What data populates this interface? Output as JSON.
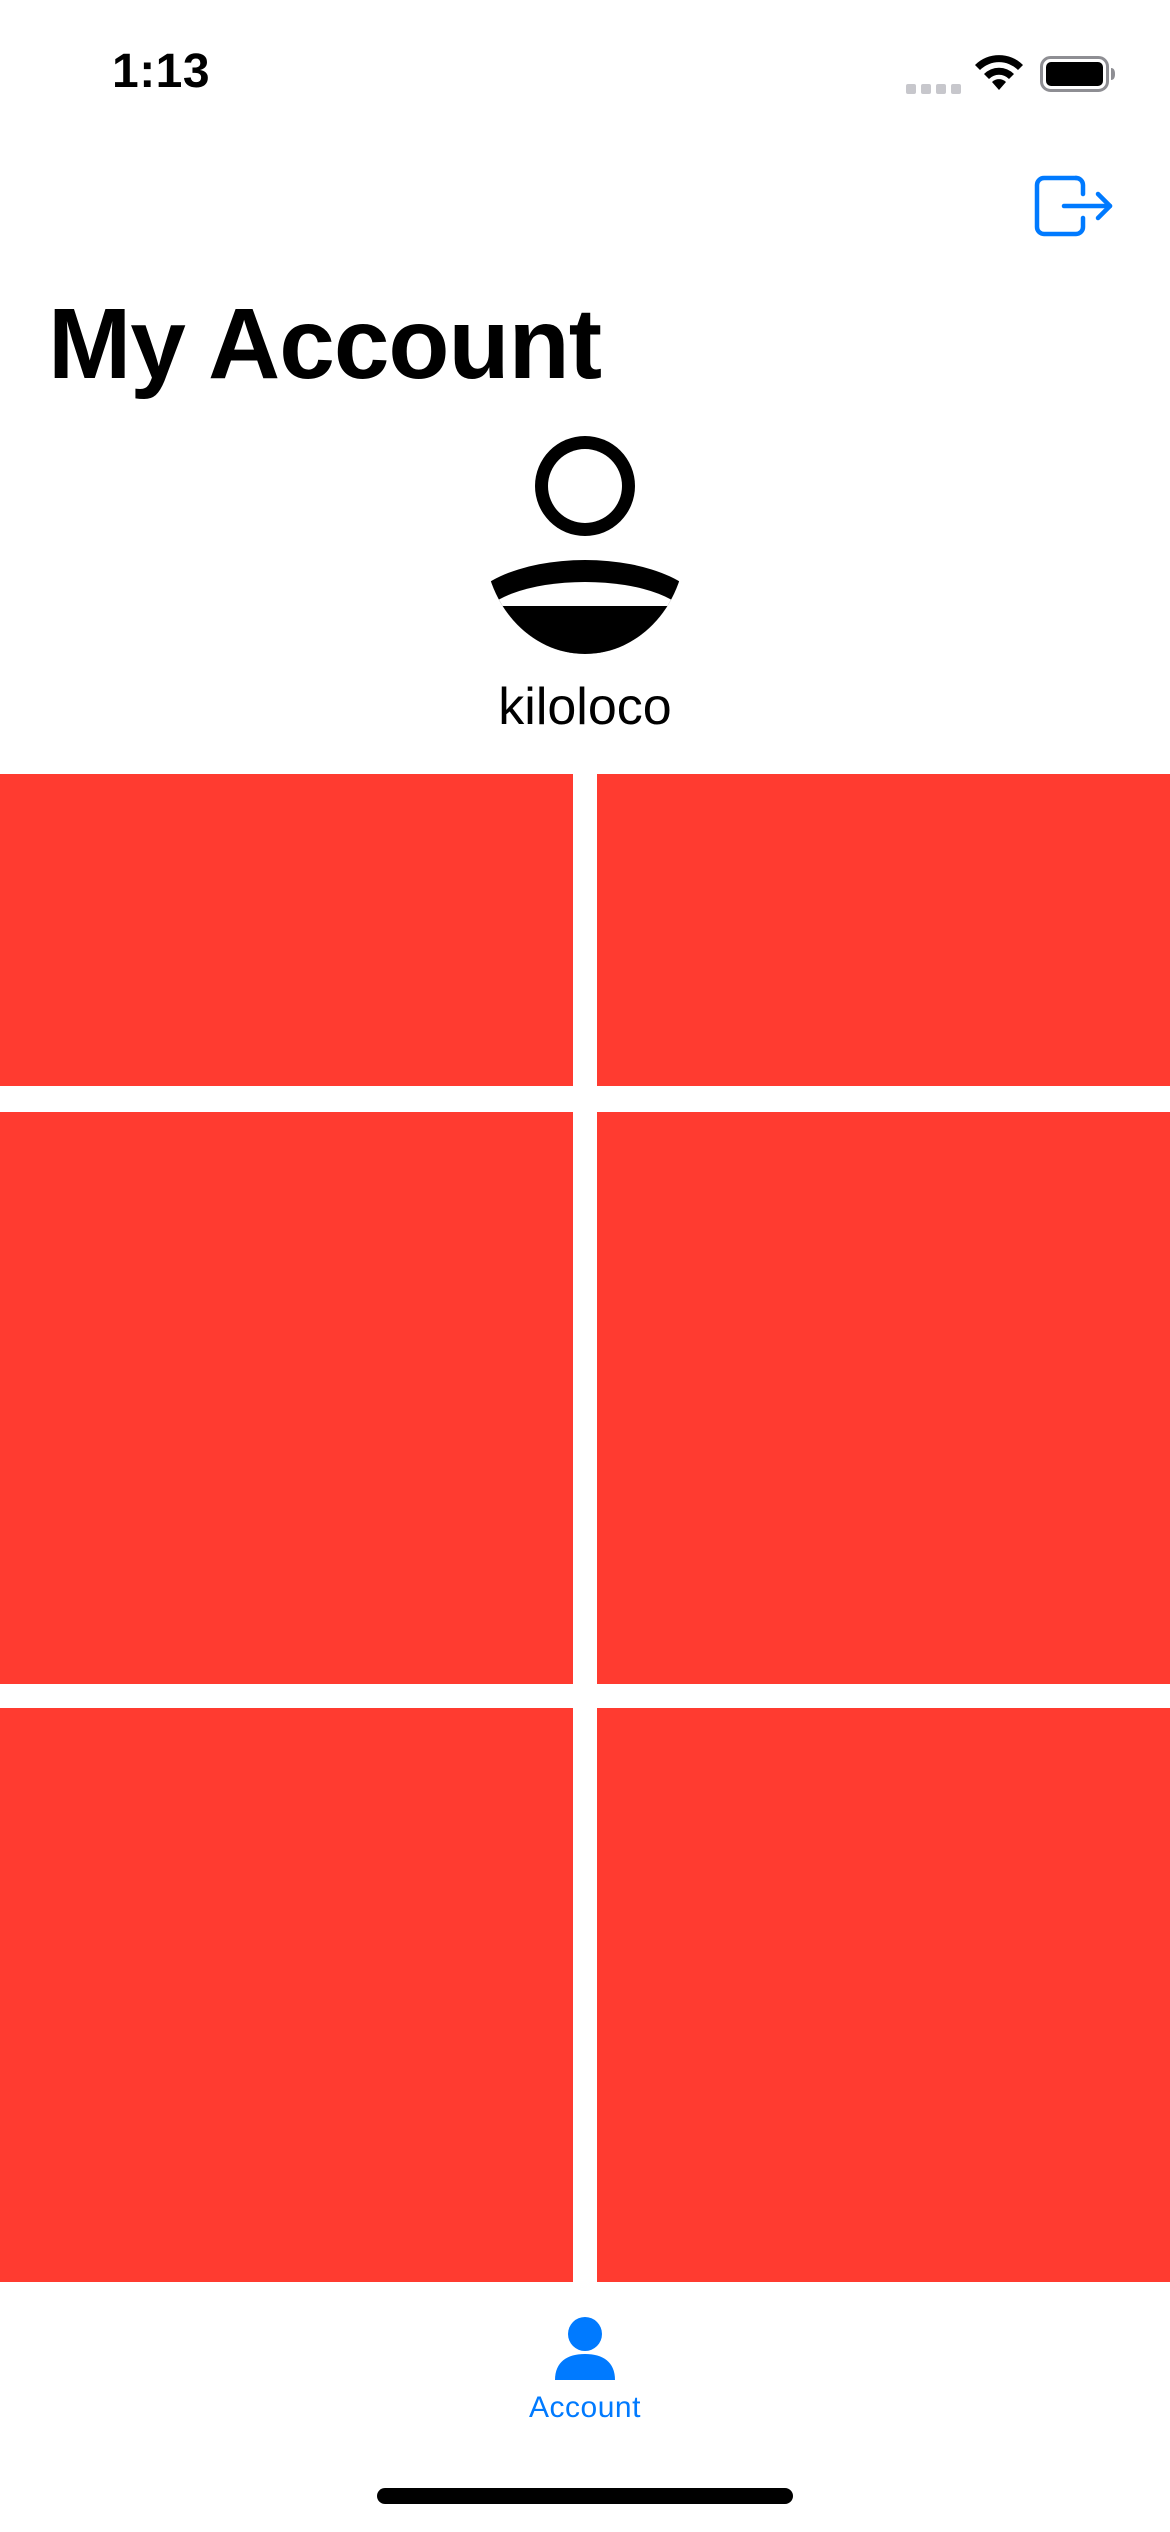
{
  "status_bar": {
    "time": "1:13"
  },
  "nav": {
    "logout_icon": "logout-icon"
  },
  "page": {
    "title": "My Account"
  },
  "profile": {
    "avatar_icon": "person-icon",
    "username": "kiloloco"
  },
  "grid": {
    "columns": 2,
    "rows": 3,
    "tile_color": "#FF3B30",
    "tile_count": 6
  },
  "tab_bar": {
    "items": [
      {
        "label": "Account",
        "icon": "person-fill-icon",
        "selected": true
      }
    ]
  },
  "colors": {
    "accent": "#007AFF",
    "tile": "#FF3B30",
    "text": "#000000",
    "background": "#FFFFFF"
  }
}
